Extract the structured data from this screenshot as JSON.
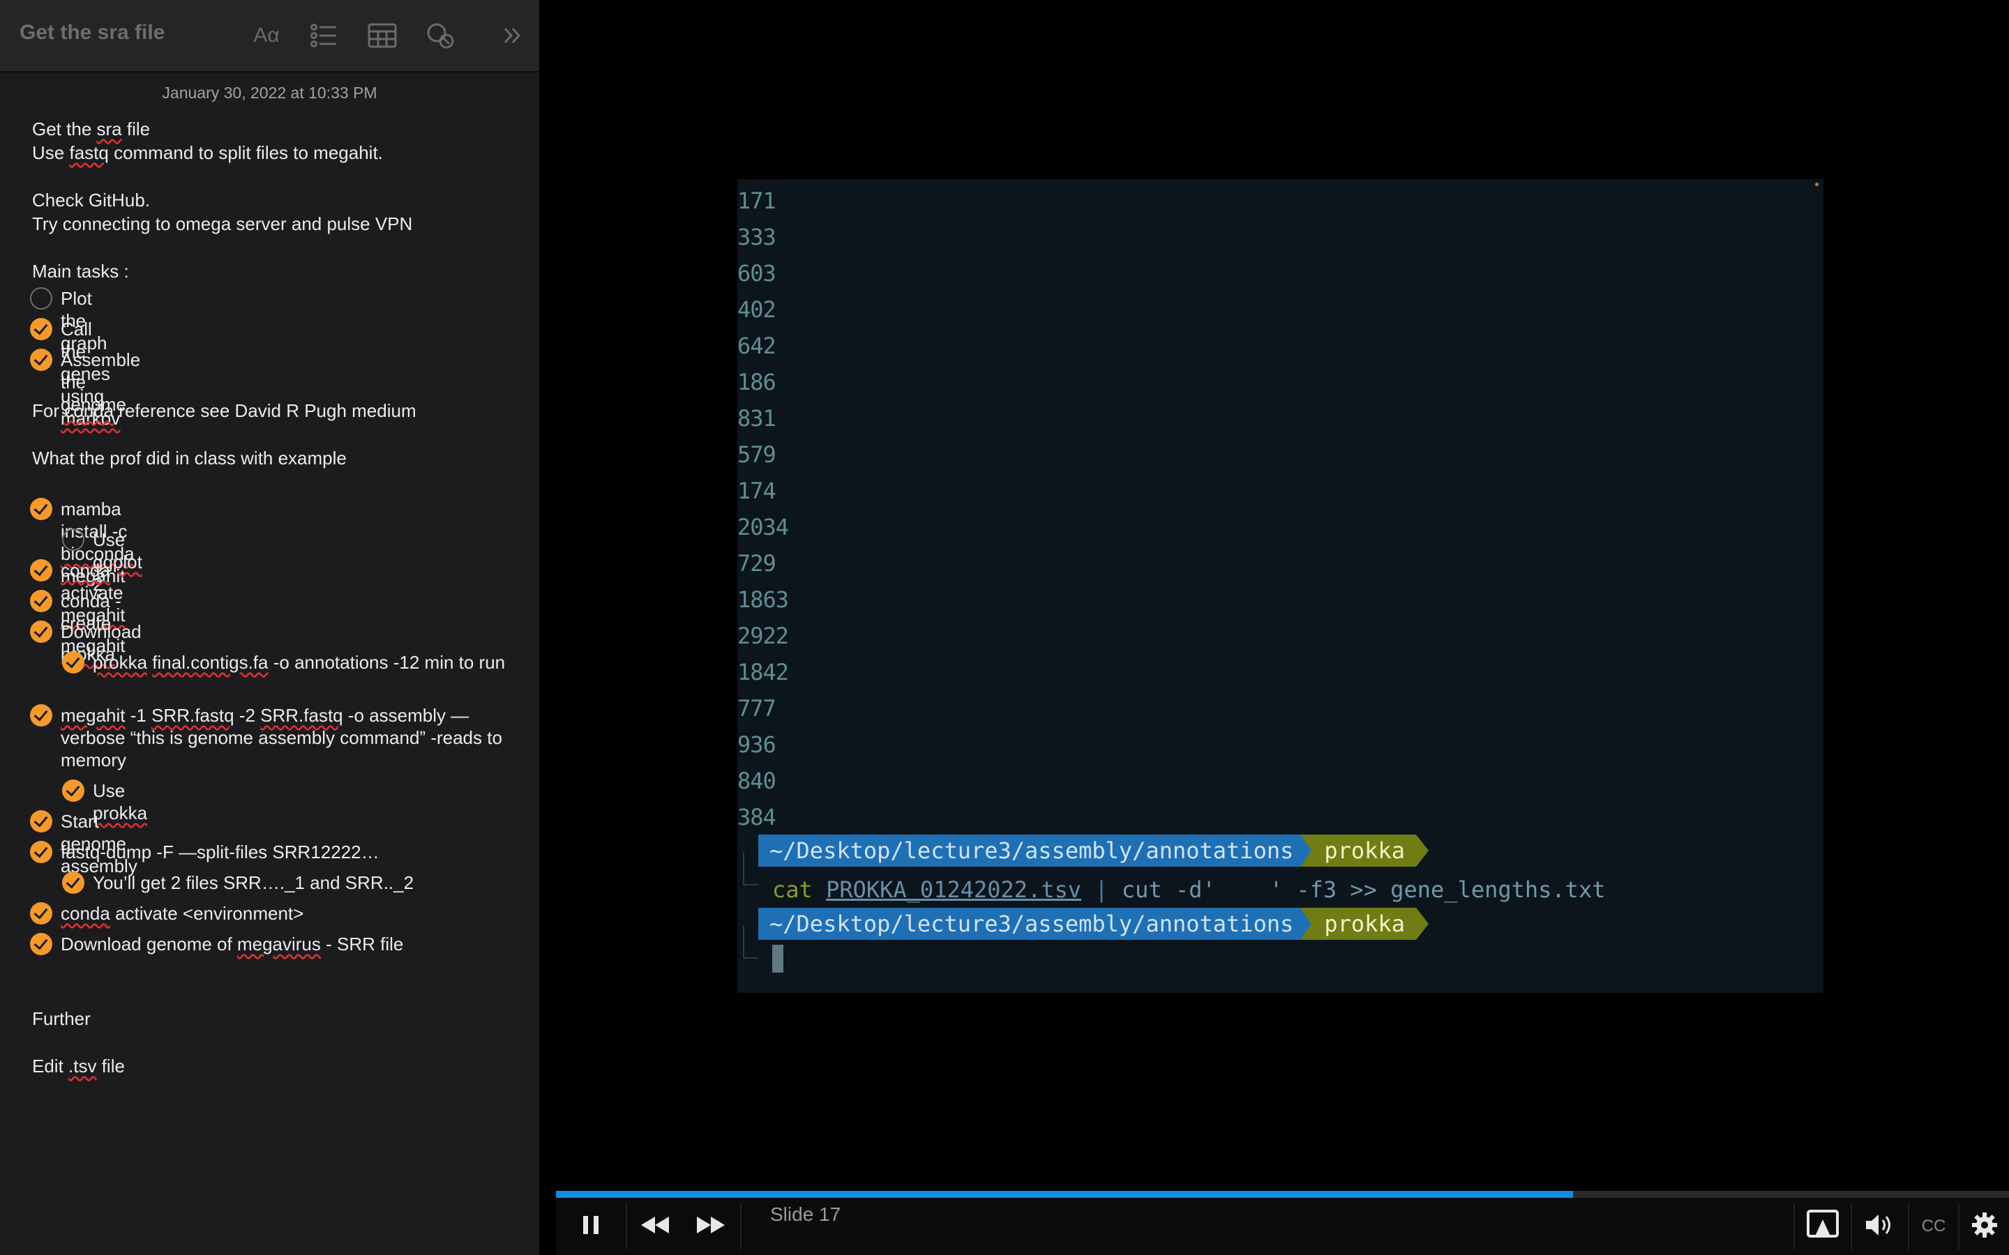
{
  "notes": {
    "title": "Get the sra file",
    "date": "January 30, 2022 at 10:33 PM",
    "toolbar_icons": [
      "text-format-icon",
      "checklist-icon",
      "table-icon",
      "share-icon",
      "expand-icon"
    ],
    "lines": {
      "l1_pre": "Get the ",
      "l1_sq": "sra",
      "l1_post": " file",
      "l2_pre": "Use ",
      "l2_sq": "fastq",
      "l2_post": " command to split files to megahit.",
      "l3": "Check GitHub.",
      "l4": "Try connecting to omega server and pulse VPN",
      "l5": "Main tasks :",
      "l6_pre": "For ",
      "l6_sq": "conda",
      "l6_post": " reference see David R Pugh medium",
      "l7": "What the prof did in class with example",
      "l8": "Further",
      "l9_pre": "Edit ",
      "l9_sq": ".tsv",
      "l9_post": " file"
    },
    "main_tasks": [
      {
        "text": "Plot the graph",
        "checked": false
      },
      {
        "pre": "Call the genes using ",
        "sq": "markov",
        "checked": true
      },
      {
        "text": "Assemble the genome",
        "checked": true
      }
    ],
    "class_tasks": {
      "t1_pre": "mamba install -c ",
      "t1_sq": "bioconda",
      "t1_post": " megahit",
      "t2_pre": "Use ",
      "t2_sq": "ggplot",
      "t2_post": " 2",
      "t3_sq1": "conda",
      "t3_mid": " activate ",
      "t3_sq2": "megahit",
      "t4": "conda -create megahit",
      "t5_pre": "Download ",
      "t5_sq": "prokka",
      "t6_sq1": "prokka",
      "t6_mid": " ",
      "t6_sq2": "final.contigs.fa",
      "t6_post": " -o annotations -12 min to run",
      "t7_sq1": "megahit",
      "t7_mid1": " -1 ",
      "t7_sq2": "SRR.fastq",
      "t7_mid2": " -2 ",
      "t7_sq3": "SRR.fastq",
      "t7_post": " -o assembly —verbose “this is genome assembly command” -reads to memory",
      "t8_pre": "Use ",
      "t8_sq": "prokka",
      "t9": "Start genome assembly",
      "t10": "fastq-dump -F —split-files SRR12222…",
      "t11": "You’ll get 2 files SRR…._1 and SRR.._2",
      "t12_sq": "conda",
      "t12_post": " activate <environment>",
      "t13_pre": "Download genome of ",
      "t13_sq": "megavirus",
      "t13_post": " - SRR file"
    }
  },
  "terminal": {
    "numbers": [
      "171",
      "333",
      "603",
      "402",
      "642",
      "186",
      "831",
      "579",
      "174",
      "2034",
      "729",
      "1863",
      "2922",
      "1842",
      "777",
      "936",
      "840",
      "384"
    ],
    "prompt_path": "~/Desktop/lecture3/assembly/annotations",
    "prompt_env": "prokka",
    "cmd_cat": "cat ",
    "cmd_file": "PROKKA_01242022.tsv",
    "cmd_pipe": " | ",
    "cmd_cut": "cut -d'    ' -f3 >> gene_lengths.txt"
  },
  "player": {
    "slide_label": "Slide 17",
    "progress": 0.7,
    "cc_label": "CC",
    "accent_color": "#0e8de0"
  }
}
